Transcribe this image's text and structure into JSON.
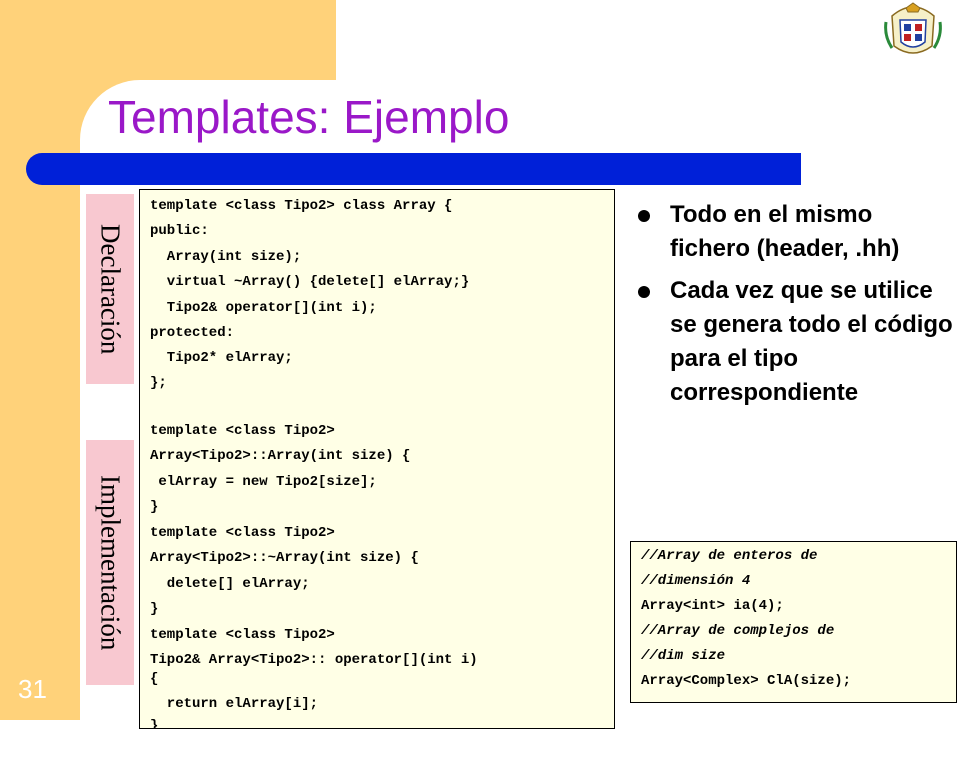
{
  "slide": {
    "title": "Templates: Ejemplo",
    "number": "31",
    "colors": {
      "accent_bar": "#0020d8",
      "title": "#9a18c8",
      "side_panel": "#ffd27a",
      "label_bg": "#f8c8d0",
      "code_bg": "#ffffe6"
    }
  },
  "labels": {
    "declaracion": "Declaración",
    "implementacion": "Implementación"
  },
  "code": {
    "lines": [
      "template <class Tipo2> class Array {",
      "public:",
      "  Array(int size);",
      "  virtual ~Array() {delete[] elArray;}",
      "  Tipo2& operator[](int i);",
      "protected:",
      "  Tipo2* elArray;",
      "};",
      "",
      "template <class Tipo2>",
      "Array<Tipo2>::Array(int size) {",
      " elArray = new Tipo2[size];",
      "}",
      "template <class Tipo2>",
      "Array<Tipo2>::~Array(int size) {",
      "  delete[] elArray;",
      "}",
      "template <class Tipo2>",
      "Tipo2& Array<Tipo2>:: operator[](int i)",
      "{",
      "  return elArray[i];",
      "}"
    ]
  },
  "bullets": [
    "Todo en el mismo fichero (header, .hh)",
    "Cada vez que se utilice se genera todo el código para el tipo correspondiente"
  ],
  "example": {
    "lines": [
      "//Array de enteros de",
      "//dimensión 4",
      "Array<int> ia(4);",
      "//Array de complejos de",
      "//dim size",
      "Array<Complex> ClA(size);"
    ]
  },
  "icons": {
    "crest": "university-crest-icon"
  }
}
